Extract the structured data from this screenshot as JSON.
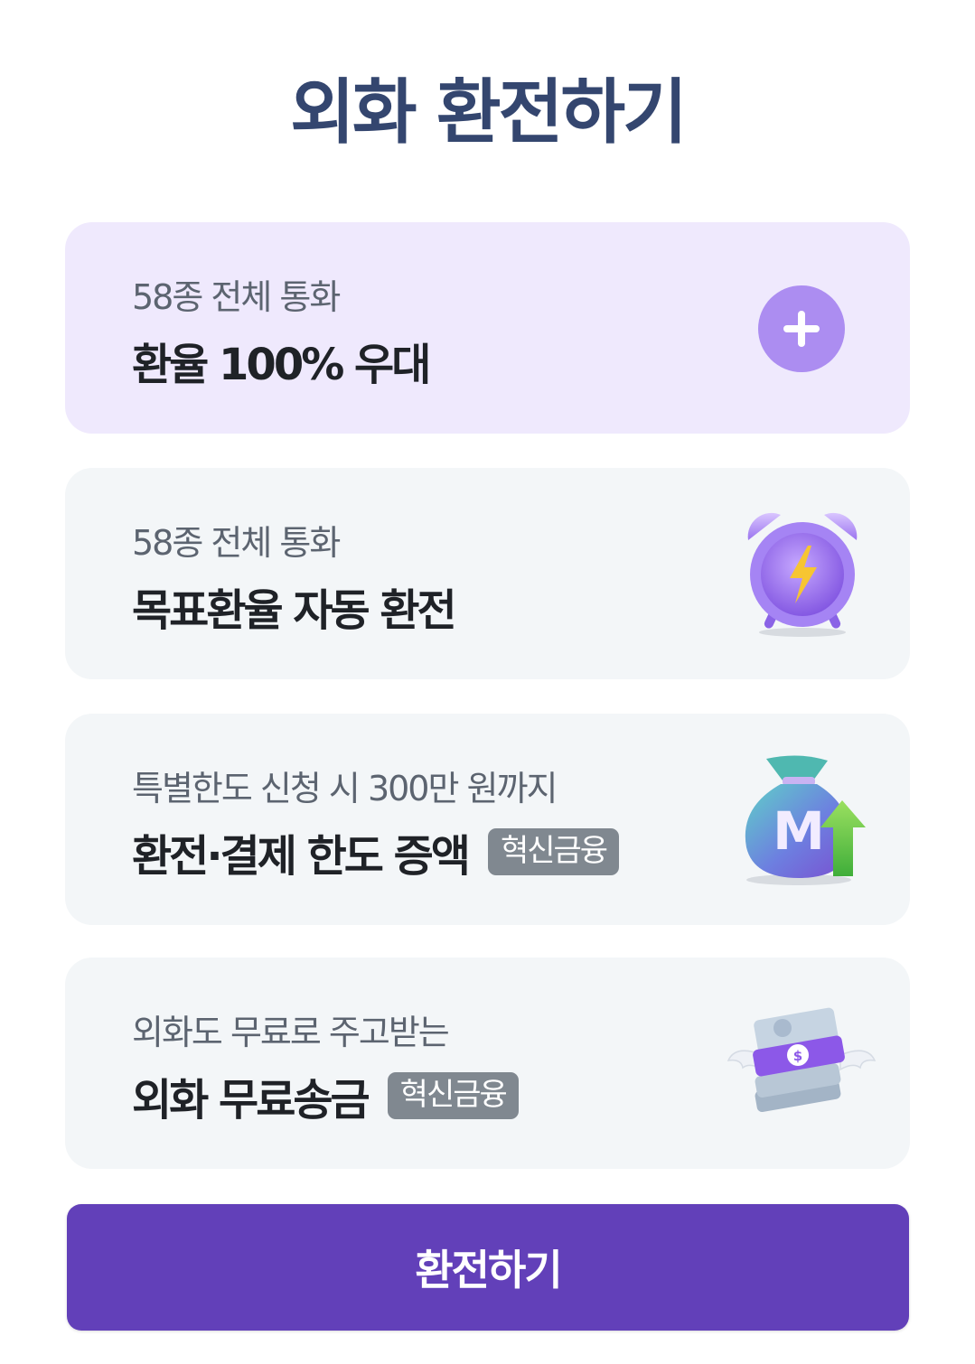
{
  "header": {
    "title": "외화 환전하기"
  },
  "cards": [
    {
      "sub": "58종 전체 통화",
      "main": "환율 100% 우대",
      "icon": "plus-icon"
    },
    {
      "sub": "58종 전체 통화",
      "main": "목표환율 자동 환전",
      "icon": "alarm-clock-icon"
    },
    {
      "sub": "특별한도 신청 시 300만 원까지",
      "main": "환전·결제 한도 증액",
      "tag": "혁신금융",
      "icon": "money-bag-up-icon"
    },
    {
      "sub": "외화도 무료로 주고받는",
      "main": "외화 무료송금",
      "tag": "혁신금융",
      "icon": "flying-money-icon"
    }
  ],
  "cta": {
    "label": "환전하기"
  },
  "colors": {
    "title": "#34466f",
    "highlight_card": "#efe9fd",
    "card": "#f3f6f8",
    "primary": "#6240b9",
    "plus_button": "#ac8df1"
  }
}
